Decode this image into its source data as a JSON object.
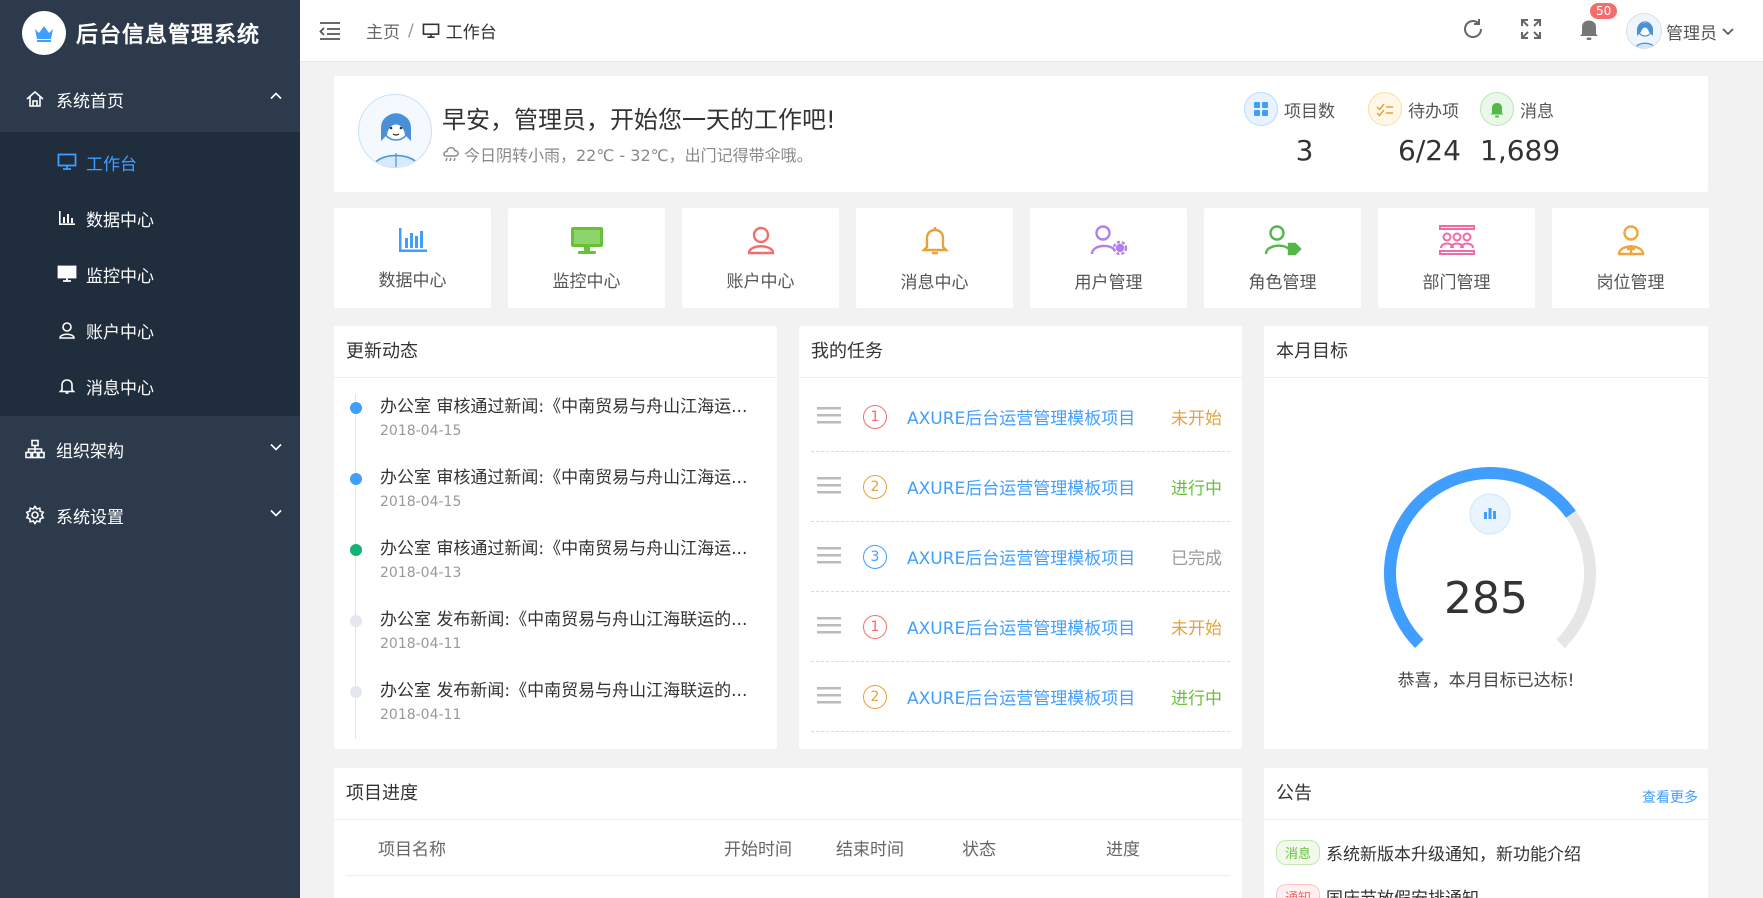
{
  "brand": {
    "title": "后台信息管理系统"
  },
  "sidebar": {
    "home": {
      "label": "系统首页"
    },
    "sub_items": [
      {
        "label": "工作台",
        "icon": "monitor-icon"
      },
      {
        "label": "数据中心",
        "icon": "bar-chart-icon"
      },
      {
        "label": "监控中心",
        "icon": "monitor-icon"
      },
      {
        "label": "账户中心",
        "icon": "user-icon"
      },
      {
        "label": "消息中心",
        "icon": "bell-icon"
      }
    ],
    "org": {
      "label": "组织架构"
    },
    "settings": {
      "label": "系统设置"
    }
  },
  "header": {
    "breadcrumb_home": "主页",
    "breadcrumb_sep": "/",
    "breadcrumb_current": "工作台",
    "notification_count": "50",
    "user_name": "管理员"
  },
  "welcome": {
    "greeting": "早安，管理员，开始您一天的工作吧!",
    "weather": "今日阴转小雨，22℃ - 32℃，出门记得带伞哦。",
    "stats": [
      {
        "label": "项目数",
        "value": "3"
      },
      {
        "label": "待办项",
        "value": "6/24"
      },
      {
        "label": "消息",
        "value": "1,689"
      }
    ]
  },
  "quick_links": [
    {
      "label": "数据中心",
      "color": "#409eff",
      "icon": "bar-chart-icon"
    },
    {
      "label": "监控中心",
      "color": "#67c23a",
      "icon": "monitor-icon"
    },
    {
      "label": "账户中心",
      "color": "#f56c6c",
      "icon": "user-icon"
    },
    {
      "label": "消息中心",
      "color": "#e6a23c",
      "icon": "bell-icon"
    },
    {
      "label": "用户管理",
      "color": "#b37feb",
      "icon": "user-settings-icon"
    },
    {
      "label": "角色管理",
      "color": "#52b84a",
      "icon": "user-tag-icon"
    },
    {
      "label": "部门管理",
      "color": "#f06aa8",
      "icon": "department-icon"
    },
    {
      "label": "岗位管理",
      "color": "#f0a640",
      "icon": "position-icon"
    }
  ],
  "updates": {
    "title": "更新动态",
    "items": [
      {
        "text": "办公室 审核通过新闻:《中南贸易与舟山江海运...",
        "date": "2018-04-15",
        "color": "#409eff"
      },
      {
        "text": "办公室 审核通过新闻:《中南贸易与舟山江海运...",
        "date": "2018-04-15",
        "color": "#409eff"
      },
      {
        "text": "办公室 审核通过新闻:《中南贸易与舟山江海运...",
        "date": "2018-04-13",
        "color": "#13b374"
      },
      {
        "text": "办公室 发布新闻:《中南贸易与舟山江海联运的...",
        "date": "2018-04-11",
        "color": "#e4e7ed"
      },
      {
        "text": "办公室 发布新闻:《中南贸易与舟山江海联运的...",
        "date": "2018-04-11",
        "color": "#e4e7ed"
      }
    ]
  },
  "tasks": {
    "title": "我的任务",
    "items": [
      {
        "num": "1",
        "name": "AXURE后台运营管理模板项目",
        "status": "未开始",
        "num_color": "#f56c6c",
        "status_color": "#e6a23c"
      },
      {
        "num": "2",
        "name": "AXURE后台运营管理模板项目",
        "status": "进行中",
        "num_color": "#e6a23c",
        "status_color": "#67c23a"
      },
      {
        "num": "3",
        "name": "AXURE后台运营管理模板项目",
        "status": "已完成",
        "num_color": "#409eff",
        "status_color": "#999999"
      },
      {
        "num": "1",
        "name": "AXURE后台运营管理模板项目",
        "status": "未开始",
        "num_color": "#f56c6c",
        "status_color": "#e6a23c"
      },
      {
        "num": "2",
        "name": "AXURE后台运营管理模板项目",
        "status": "进行中",
        "num_color": "#e6a23c",
        "status_color": "#67c23a"
      }
    ]
  },
  "goal": {
    "title": "本月目标",
    "value": "285",
    "message": "恭喜，本月目标已达标!",
    "progress_fraction": 0.7
  },
  "projects": {
    "title": "项目进度",
    "columns": [
      "项目名称",
      "开始时间",
      "结束时间",
      "状态",
      "进度"
    ]
  },
  "notices": {
    "title": "公告",
    "more": "查看更多",
    "items": [
      {
        "tag": "消息",
        "text": "系统新版本升级通知，新功能介绍"
      },
      {
        "tag": "通知",
        "text": "国庆节放假安排通知"
      }
    ]
  }
}
